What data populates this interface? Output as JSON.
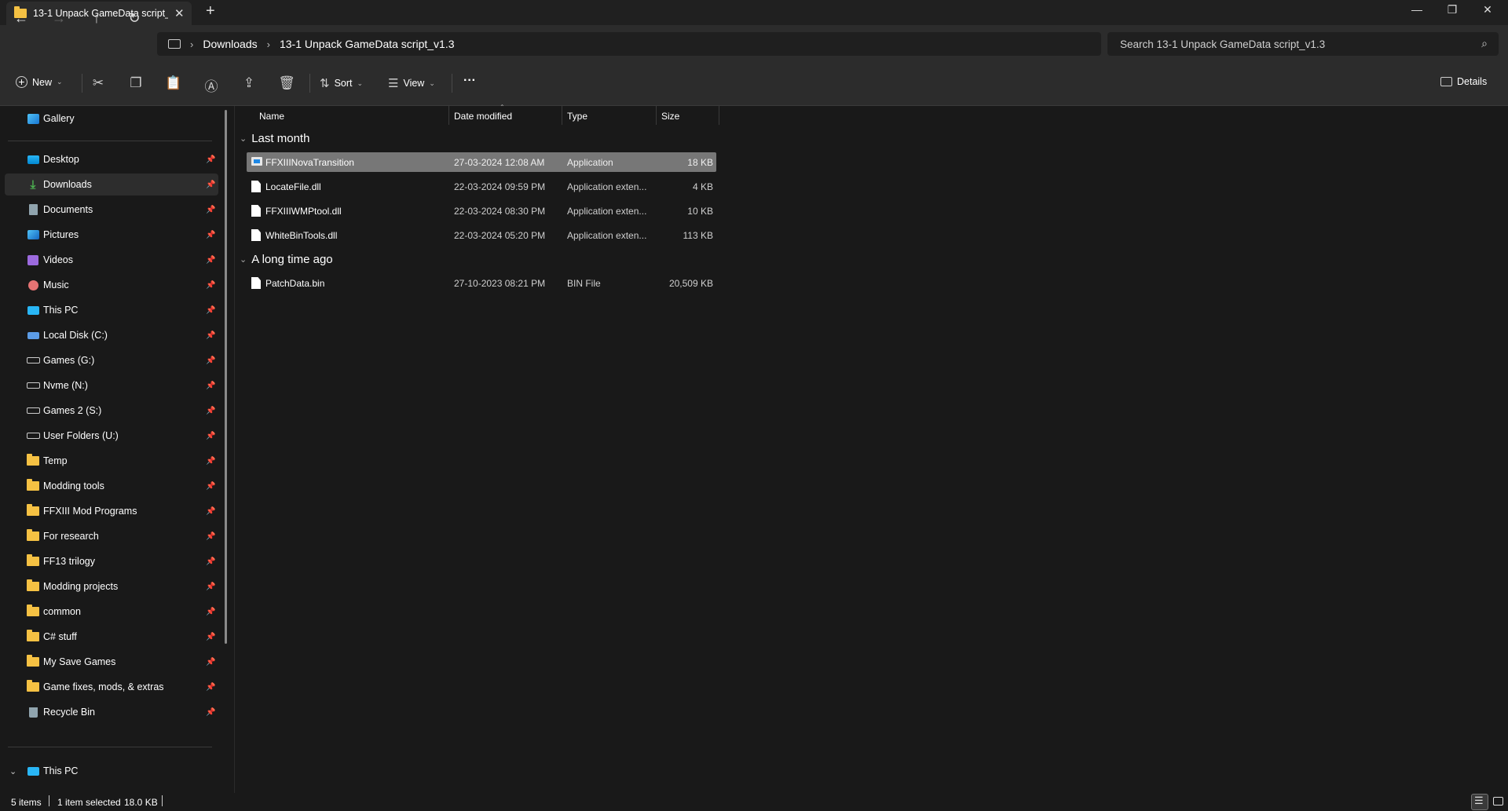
{
  "window": {
    "tab_title": "13-1 Unpack GameData script_",
    "tab_close": "✕",
    "new_tab": "+",
    "minimize": "—",
    "restore": "❐",
    "close": "✕"
  },
  "nav": {
    "breadcrumb": [
      "Downloads",
      "13-1 Unpack GameData script_v1.3"
    ],
    "search_placeholder": "Search 13-1 Unpack GameData script_v1.3"
  },
  "commandbar": {
    "new_label": "New",
    "sort_label": "Sort",
    "view_label": "View",
    "more_label": "···",
    "details_label": "Details"
  },
  "sidebar": {
    "top_item": {
      "label": "Gallery",
      "icon": "gallery-icon"
    },
    "items": [
      {
        "label": "Desktop",
        "icon": "desktop-icon"
      },
      {
        "label": "Downloads",
        "icon": "download-icon"
      },
      {
        "label": "Documents",
        "icon": "documents-icon"
      },
      {
        "label": "Pictures",
        "icon": "pictures-icon"
      },
      {
        "label": "Videos",
        "icon": "videos-icon"
      },
      {
        "label": "Music",
        "icon": "music-icon"
      },
      {
        "label": "This PC",
        "icon": "pc-icon"
      },
      {
        "label": "Local Disk (C:)",
        "icon": "local-disk-icon"
      },
      {
        "label": "Games (G:)",
        "icon": "drive-icon"
      },
      {
        "label": "Nvme (N:)",
        "icon": "drive-icon"
      },
      {
        "label": "Games 2 (S:)",
        "icon": "drive-icon"
      },
      {
        "label": "User Folders (U:)",
        "icon": "drive-icon"
      },
      {
        "label": "Temp",
        "icon": "folder-icon"
      },
      {
        "label": "Modding tools",
        "icon": "folder-icon"
      },
      {
        "label": "FFXIII Mod Programs",
        "icon": "folder-icon"
      },
      {
        "label": "For research",
        "icon": "folder-icon"
      },
      {
        "label": "FF13 trilogy",
        "icon": "folder-icon"
      },
      {
        "label": "Modding projects",
        "icon": "folder-icon"
      },
      {
        "label": "common",
        "icon": "folder-icon"
      },
      {
        "label": "C# stuff",
        "icon": "folder-icon"
      },
      {
        "label": "My Save Games",
        "icon": "folder-icon"
      },
      {
        "label": "Game fixes, mods, & extras",
        "icon": "folder-icon"
      },
      {
        "label": "Recycle Bin",
        "icon": "recycle-bin-icon"
      }
    ],
    "tree_item": {
      "label": "This PC",
      "icon": "pc-icon"
    },
    "pin_glyph": "📌"
  },
  "columns": {
    "name": "Name",
    "date": "Date modified",
    "type": "Type",
    "size": "Size"
  },
  "groups": [
    {
      "label": "Last month",
      "files": [
        {
          "name": "FFXIIINovaTransition",
          "date": "27-03-2024 12:08 AM",
          "type": "Application",
          "size": "18 KB",
          "icon": "application-icon",
          "selected": true
        },
        {
          "name": "LocateFile.dll",
          "date": "22-03-2024 09:59 PM",
          "type": "Application exten...",
          "size": "4 KB",
          "icon": "dll-file-icon",
          "selected": false
        },
        {
          "name": "FFXIIIWMPtool.dll",
          "date": "22-03-2024 08:30 PM",
          "type": "Application exten...",
          "size": "10 KB",
          "icon": "dll-file-icon",
          "selected": false
        },
        {
          "name": "WhiteBinTools.dll",
          "date": "22-03-2024 05:20 PM",
          "type": "Application exten...",
          "size": "113 KB",
          "icon": "dll-file-icon",
          "selected": false
        }
      ]
    },
    {
      "label": "A long time ago",
      "files": [
        {
          "name": "PatchData.bin",
          "date": "27-10-2023 08:21 PM",
          "type": "BIN File",
          "size": "20,509 KB",
          "icon": "file-icon",
          "selected": false
        }
      ]
    }
  ],
  "status": {
    "item_count": "5 items",
    "selection": "1 item selected",
    "selection_size": "18.0 KB"
  }
}
